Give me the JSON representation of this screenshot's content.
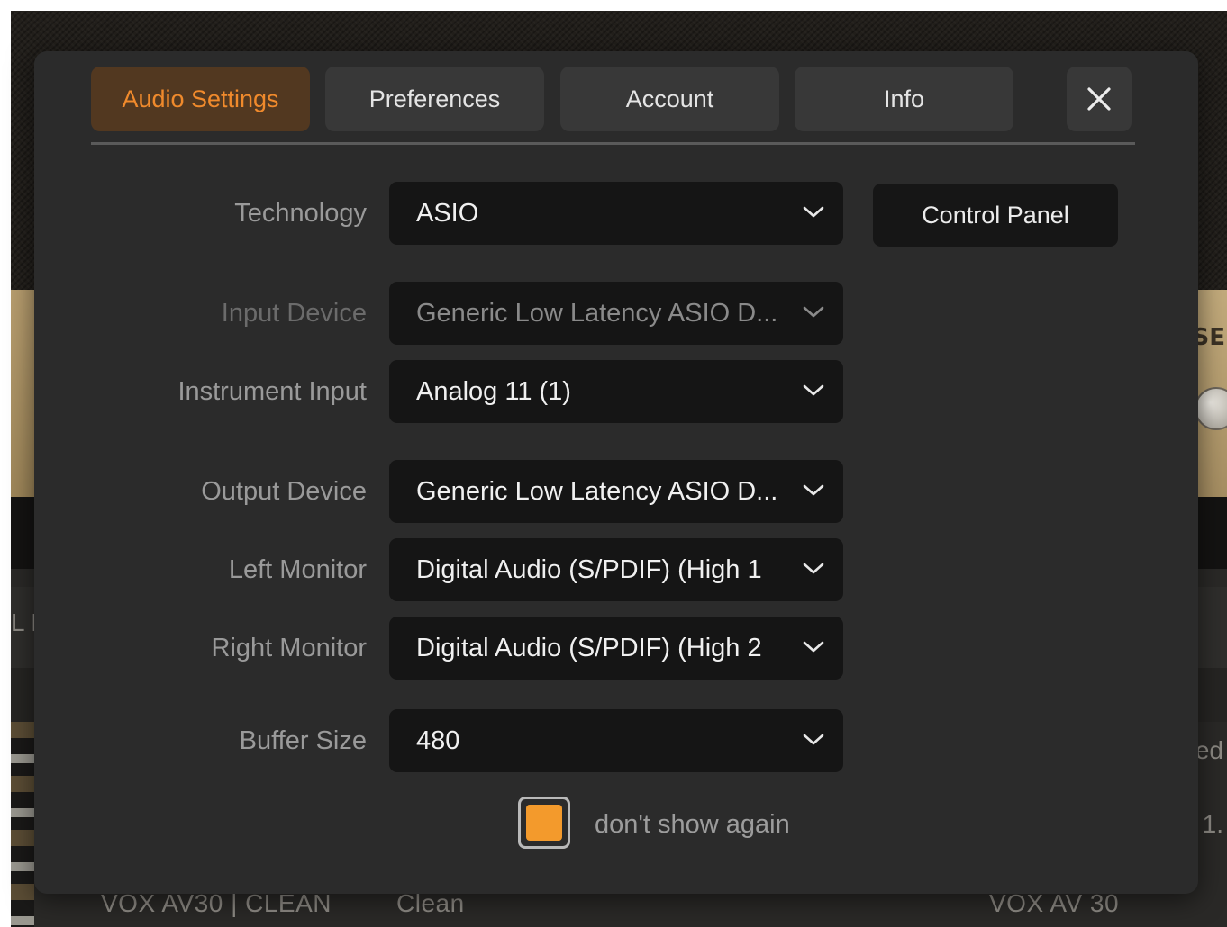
{
  "tabs": [
    {
      "label": "Audio Settings",
      "active": true
    },
    {
      "label": "Preferences",
      "active": false
    },
    {
      "label": "Account",
      "active": false
    },
    {
      "label": "Info",
      "active": false
    }
  ],
  "close_icon": "close-icon",
  "control_panel_label": "Control Panel",
  "fields": [
    {
      "label": "Technology",
      "value": "ASIO",
      "disabled": false
    },
    {
      "label": "Input Device",
      "value": "Generic Low Latency ASIO D...",
      "disabled": true
    },
    {
      "label": "Instrument Input",
      "value": "Analog 11 (1)",
      "disabled": false
    },
    {
      "label": "Output Device",
      "value": "Generic Low Latency ASIO D...",
      "disabled": false
    },
    {
      "label": "Left Monitor",
      "value": "Digital Audio (S/PDIF) (High 1",
      "disabled": false
    },
    {
      "label": "Right Monitor",
      "value": "Digital Audio (S/PDIF) (High 2",
      "disabled": false
    },
    {
      "label": "Buffer Size",
      "value": "480",
      "disabled": false
    }
  ],
  "dont_show": {
    "label": "don't show again",
    "checked": true
  },
  "background": {
    "row_preset": "VOX AV30 | CLEAN",
    "row_category": "Clean",
    "row_amp": "VOX AV 30",
    "amp_panel_text": "SE",
    "side_left_text": "L L",
    "side_right_text_1": "ed",
    "side_right_text_2": "1."
  },
  "colors": {
    "accent": "#f08a2c",
    "checkbox_fill": "#f39a2c",
    "modal_bg": "#2b2b2b",
    "select_bg": "#151515"
  }
}
